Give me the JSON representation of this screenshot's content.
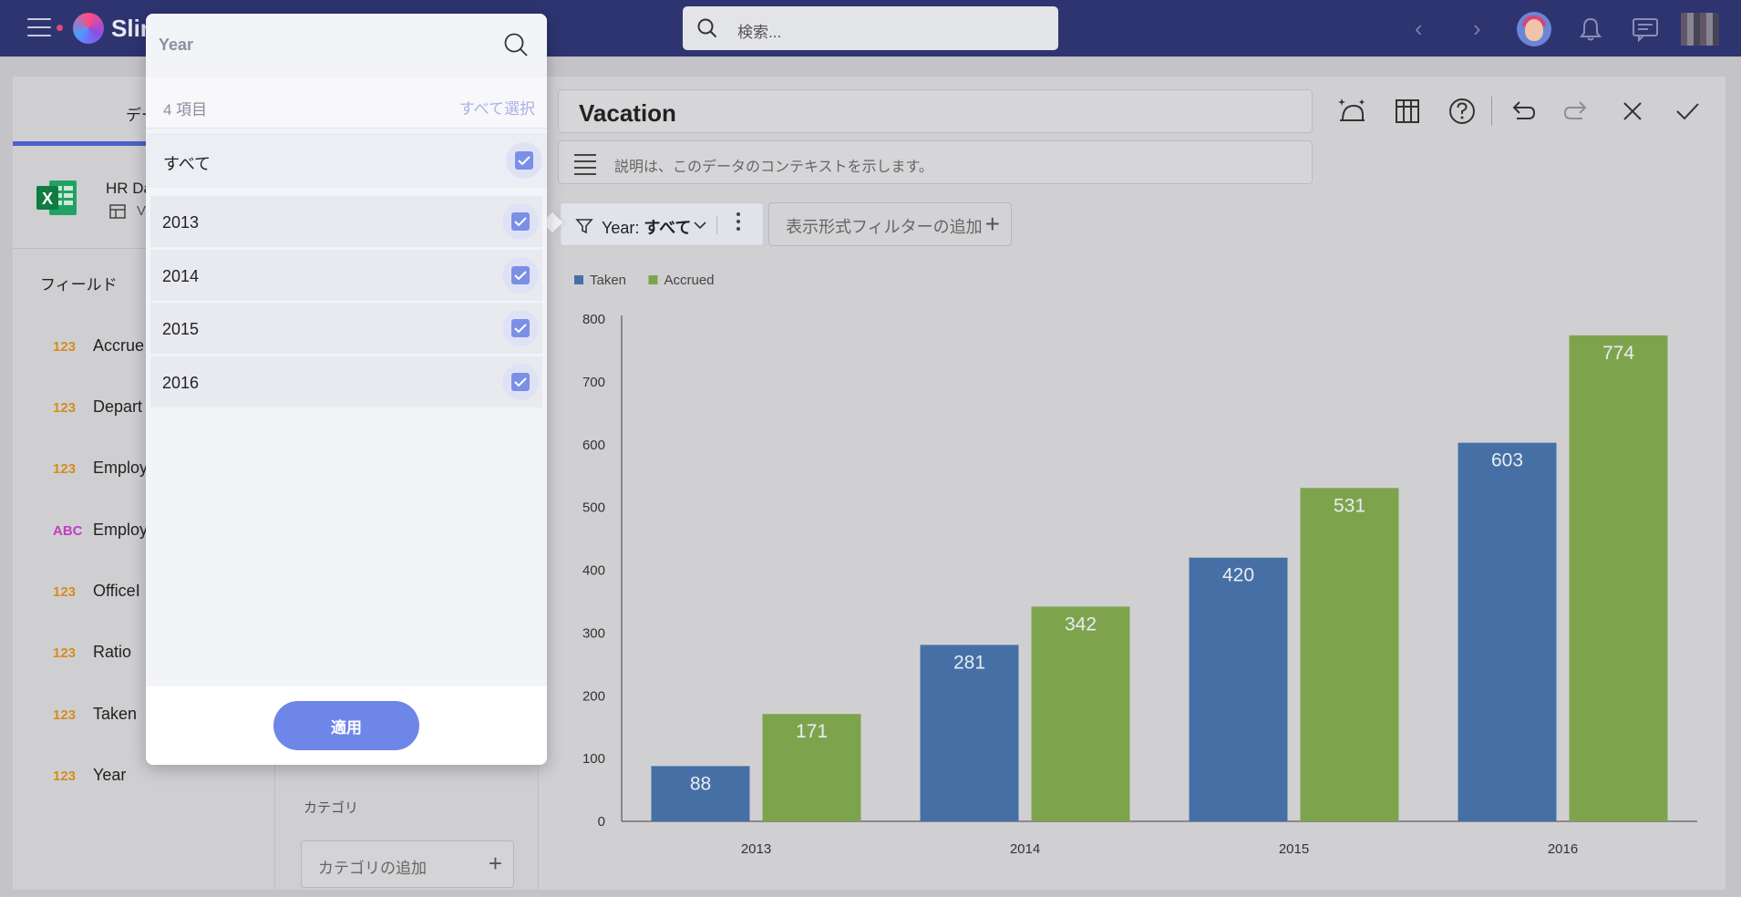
{
  "header": {
    "logo_text": "Slim",
    "search_placeholder": "検索..."
  },
  "left_panel": {
    "tab_label": "デー",
    "source_name": "HR Da",
    "source_sub": "V",
    "fields_title": "フィールド",
    "fields": [
      {
        "type": "123",
        "name": "Accrue"
      },
      {
        "type": "123",
        "name": "Depart"
      },
      {
        "type": "123",
        "name": "Employ"
      },
      {
        "type": "ABC",
        "name": "Employ"
      },
      {
        "type": "123",
        "name": "OfficeI"
      },
      {
        "type": "123",
        "name": "Ratio"
      },
      {
        "type": "123",
        "name": "Taken"
      },
      {
        "type": "123",
        "name": "Year"
      }
    ]
  },
  "middle_panel": {
    "category_label": "カテゴリ",
    "category_add": "カテゴリの追加"
  },
  "editor": {
    "title": "Vacation",
    "description_placeholder": "説明は、このデータのコンテキストを示します。",
    "filter_chip": {
      "field": "Year:",
      "value": "すべて"
    },
    "add_filter_label": "表示形式フィルターの追加"
  },
  "popup": {
    "search_placeholder": "Year",
    "count_label": "4 項目",
    "select_all_label": "すべて選択",
    "all_label": "すべて",
    "items": [
      "2013",
      "2014",
      "2015",
      "2016"
    ],
    "apply_label": "適用"
  },
  "chart_data": {
    "type": "bar",
    "categories": [
      "2013",
      "2014",
      "2015",
      "2016"
    ],
    "series": [
      {
        "name": "Taken",
        "values": [
          88,
          281,
          420,
          603
        ],
        "color": "#4670a5"
      },
      {
        "name": "Accrued",
        "values": [
          171,
          342,
          531,
          774
        ],
        "color": "#7da44d"
      }
    ],
    "ylim": [
      0,
      800
    ],
    "yticks": [
      0,
      100,
      200,
      300,
      400,
      500,
      600,
      700,
      800
    ],
    "legend_position": "top-left",
    "grid": false
  }
}
